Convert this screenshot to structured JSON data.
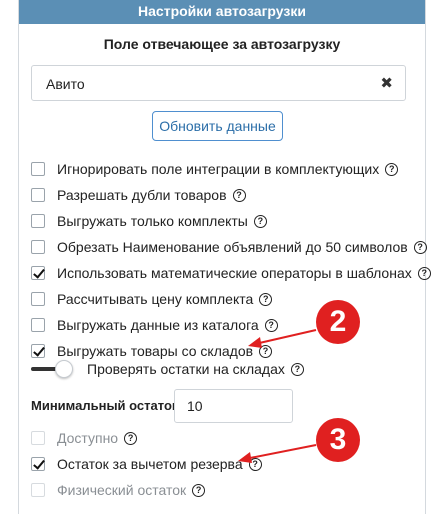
{
  "header": {
    "title": "Настройки автозагрузки"
  },
  "field": {
    "title": "Поле отвечающее за автозагрузку",
    "value": "Авито"
  },
  "refresh_button": {
    "label": "Обновить данные"
  },
  "options": [
    {
      "label": "Игнорировать поле интеграции в комплектующих",
      "checked": false
    },
    {
      "label": "Разрешать дубли товаров",
      "checked": false
    },
    {
      "label": "Выгружать только комплекты",
      "checked": false
    },
    {
      "label": "Обрезать Наименование объявлений до 50 символов",
      "checked": false
    },
    {
      "label": "Использовать математические операторы в шаблонах",
      "checked": true
    },
    {
      "label": "Рассчитывать цену комплекта",
      "checked": false
    },
    {
      "label": "Выгружать данные из каталога",
      "checked": false
    },
    {
      "label": "Выгружать товары со складов",
      "checked": true
    }
  ],
  "stock_toggle": {
    "label": "Проверять остатки на складах",
    "on": false
  },
  "min_stock": {
    "label": "Минимальный остаток",
    "value": "10"
  },
  "stock_options": [
    {
      "label": "Доступно",
      "checked": false,
      "disabled": true
    },
    {
      "label": "Остаток за вычетом резерва",
      "checked": true,
      "disabled": false
    },
    {
      "label": "Физический остаток",
      "checked": false,
      "disabled": true
    }
  ],
  "markers": [
    "2",
    "3"
  ],
  "colors": {
    "header": "#5b8fb5",
    "button_border": "#4f8fcf",
    "marker": "#e02020"
  }
}
